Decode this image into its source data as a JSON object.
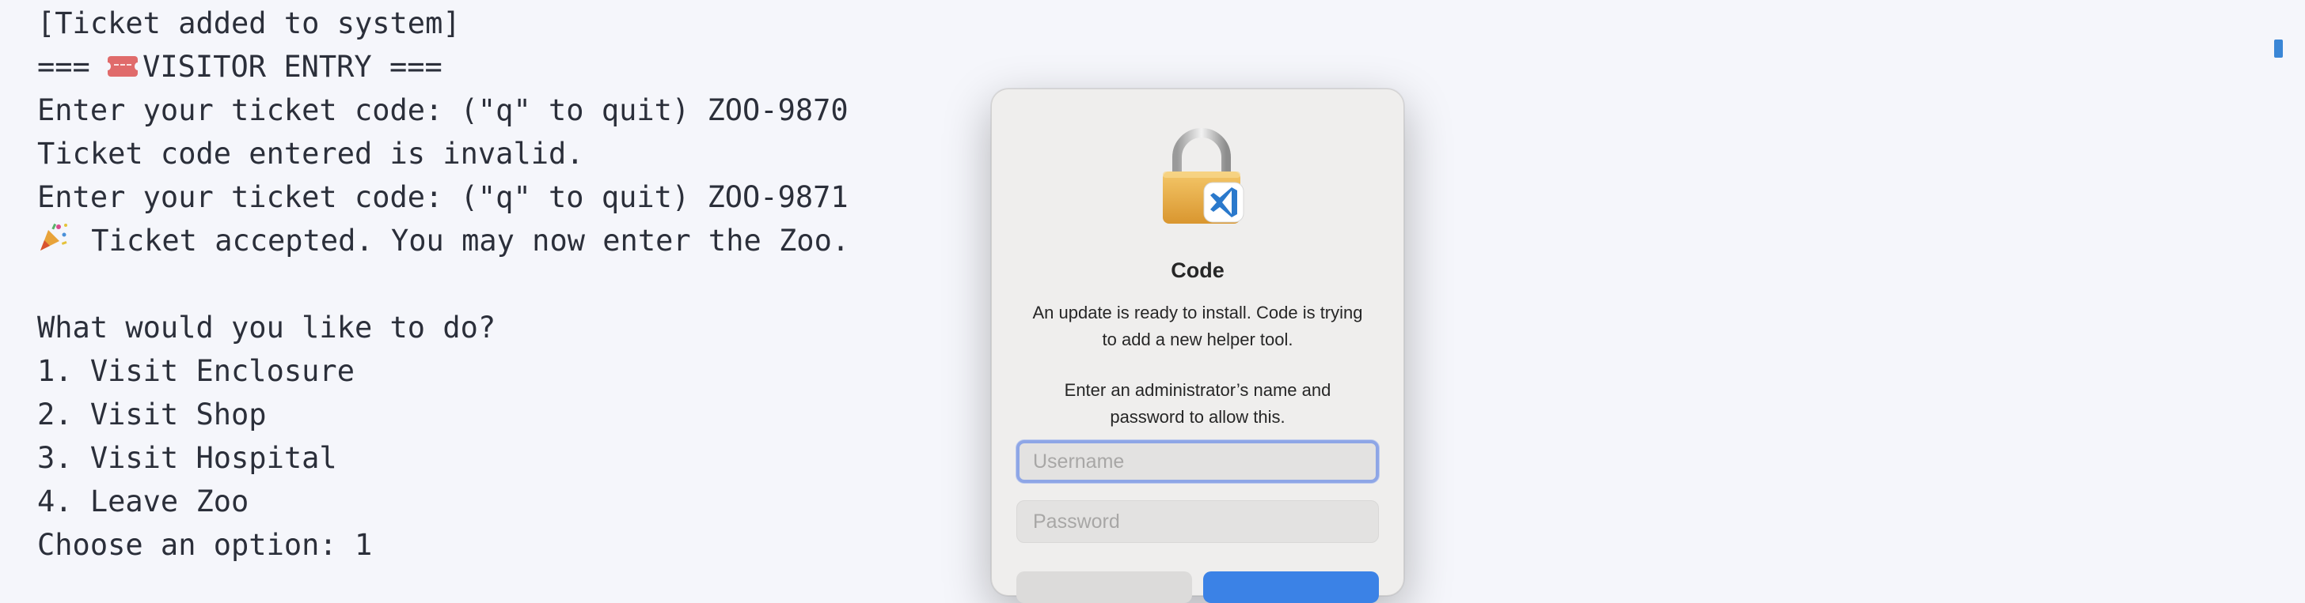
{
  "terminal": {
    "lines": [
      "[Ticket added to system]",
      "=== ",
      "VISITOR ENTRY ===",
      "Enter your ticket code: (\"q\" to quit) ZOO-9870",
      "Ticket code entered is invalid.",
      "Enter your ticket code: (\"q\" to quit) ZOO-9871",
      " Ticket accepted. You may now enter the Zoo.",
      "",
      "What would you like to do?",
      "1. Visit Enclosure",
      "2. Visit Shop",
      "3. Visit Hospital",
      "4. Leave Zoo",
      "Choose an option: 1"
    ],
    "icons": {
      "ticket": "ticket-icon",
      "party": "party-popper-icon"
    }
  },
  "dialog": {
    "app_icon": "lock-with-vscode-icon",
    "title": "Code",
    "message": "An update is ready to install. Code is trying to add a new helper tool.",
    "prompt": "Enter an administrator’s name and password to allow this.",
    "username_placeholder": "Username",
    "username_value": "",
    "password_placeholder": "Password",
    "password_value": "",
    "focus_color": "#8ea6e6",
    "accent_color": "#3b82e6"
  },
  "colors": {
    "terminal_bg": "#f5f6fb",
    "terminal_text": "#2b2f3a",
    "scroll_marker": "#3a86d6"
  }
}
